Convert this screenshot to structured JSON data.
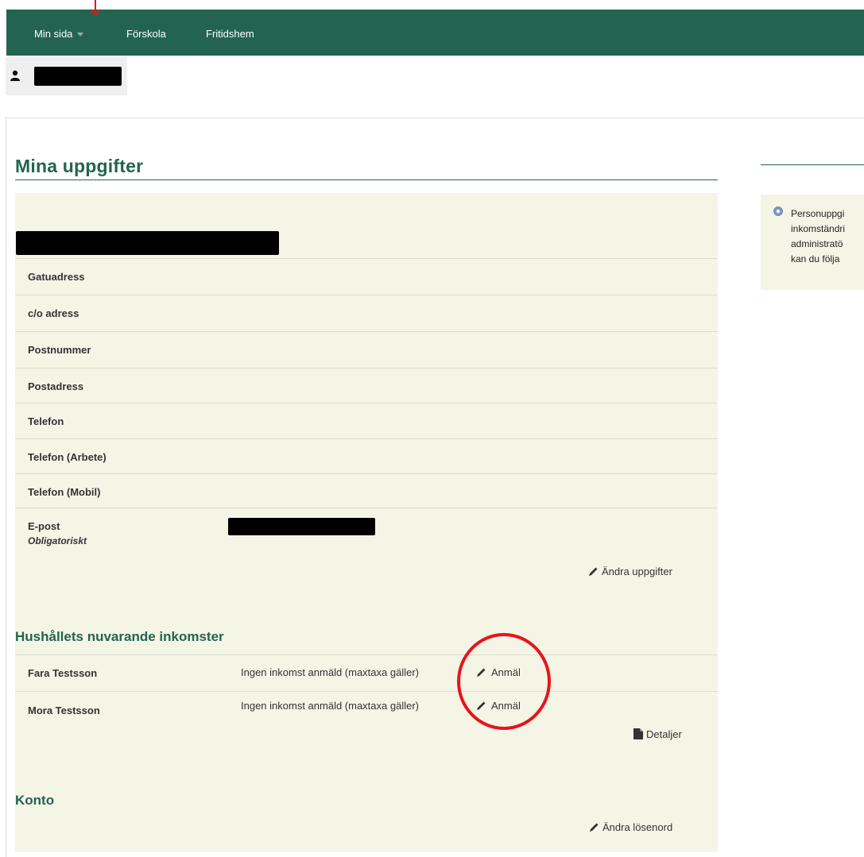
{
  "nav": {
    "items": [
      {
        "label": "Min sida"
      },
      {
        "label": "Förskola"
      },
      {
        "label": "Fritidshem"
      }
    ]
  },
  "page": {
    "title": "Mina uppgifter"
  },
  "info": {
    "lines": [
      "Personuppgi",
      "inkomständri",
      "administratö",
      "kan du följa"
    ]
  },
  "details": {
    "fields": [
      {
        "label": "Gatuadress"
      },
      {
        "label": "c/o adress"
      },
      {
        "label": "Postnummer"
      },
      {
        "label": "Postadress"
      },
      {
        "label": "Telefon"
      },
      {
        "label": "Telefon (Arbete)"
      },
      {
        "label": "Telefon (Mobil)"
      }
    ],
    "email": {
      "label": "E-post",
      "required": "Obligatoriskt"
    },
    "edit_label": "Ändra uppgifter"
  },
  "income": {
    "title": "Hushållets nuvarande inkomster",
    "rows": [
      {
        "name": "Fara Testsson",
        "status": "Ingen inkomst anmäld (maxtaxa gäller)",
        "action": "Anmäl"
      },
      {
        "name": "Mora Testsson",
        "status": "Ingen inkomst anmäld (maxtaxa gäller)",
        "action": "Anmäl"
      }
    ],
    "details_label": "Detaljer"
  },
  "account": {
    "title": "Konto",
    "change_password_label": "Ändra lösenord"
  },
  "colors": {
    "brand_green": "#236450",
    "panel_bg": "#f5f5e6",
    "annotation_red": "#e8141c"
  }
}
